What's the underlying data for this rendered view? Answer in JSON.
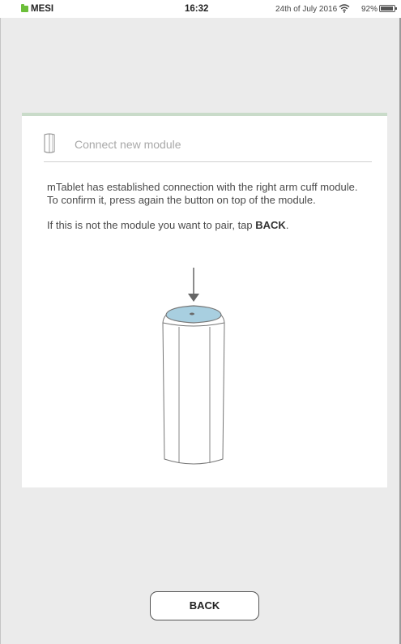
{
  "status_bar": {
    "brand": "MESI",
    "time": "16:32",
    "date": "24th of July 2016",
    "battery_percent_label": "92%",
    "battery_level": 0.92,
    "brand_color": "#6cbf3a"
  },
  "dialog": {
    "title": "Connect new module",
    "accent_color": "#c9dbc9",
    "message_line1": "mTablet has established connection with the right arm cuff module. To confirm it, press again the button on top of the module.",
    "message_line2_prefix": "If this is not the module you want to pair, tap ",
    "message_line2_emphasis": "BACK",
    "message_line2_suffix": ".",
    "module_button_color": "#a8cfe0"
  },
  "footer": {
    "back_label": "BACK"
  }
}
